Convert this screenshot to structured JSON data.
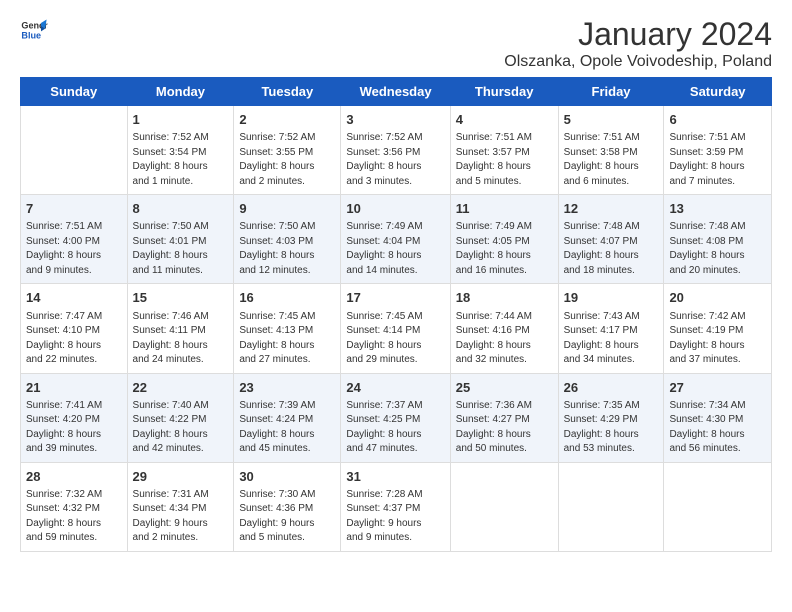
{
  "header": {
    "logo_line1": "General",
    "logo_line2": "Blue",
    "month_year": "January 2024",
    "location": "Olszanka, Opole Voivodeship, Poland"
  },
  "weekdays": [
    "Sunday",
    "Monday",
    "Tuesday",
    "Wednesday",
    "Thursday",
    "Friday",
    "Saturday"
  ],
  "weeks": [
    {
      "days": [
        {
          "num": "",
          "info": ""
        },
        {
          "num": "1",
          "info": "Sunrise: 7:52 AM\nSunset: 3:54 PM\nDaylight: 8 hours\nand 1 minute."
        },
        {
          "num": "2",
          "info": "Sunrise: 7:52 AM\nSunset: 3:55 PM\nDaylight: 8 hours\nand 2 minutes."
        },
        {
          "num": "3",
          "info": "Sunrise: 7:52 AM\nSunset: 3:56 PM\nDaylight: 8 hours\nand 3 minutes."
        },
        {
          "num": "4",
          "info": "Sunrise: 7:51 AM\nSunset: 3:57 PM\nDaylight: 8 hours\nand 5 minutes."
        },
        {
          "num": "5",
          "info": "Sunrise: 7:51 AM\nSunset: 3:58 PM\nDaylight: 8 hours\nand 6 minutes."
        },
        {
          "num": "6",
          "info": "Sunrise: 7:51 AM\nSunset: 3:59 PM\nDaylight: 8 hours\nand 7 minutes."
        }
      ]
    },
    {
      "days": [
        {
          "num": "7",
          "info": "Sunrise: 7:51 AM\nSunset: 4:00 PM\nDaylight: 8 hours\nand 9 minutes."
        },
        {
          "num": "8",
          "info": "Sunrise: 7:50 AM\nSunset: 4:01 PM\nDaylight: 8 hours\nand 11 minutes."
        },
        {
          "num": "9",
          "info": "Sunrise: 7:50 AM\nSunset: 4:03 PM\nDaylight: 8 hours\nand 12 minutes."
        },
        {
          "num": "10",
          "info": "Sunrise: 7:49 AM\nSunset: 4:04 PM\nDaylight: 8 hours\nand 14 minutes."
        },
        {
          "num": "11",
          "info": "Sunrise: 7:49 AM\nSunset: 4:05 PM\nDaylight: 8 hours\nand 16 minutes."
        },
        {
          "num": "12",
          "info": "Sunrise: 7:48 AM\nSunset: 4:07 PM\nDaylight: 8 hours\nand 18 minutes."
        },
        {
          "num": "13",
          "info": "Sunrise: 7:48 AM\nSunset: 4:08 PM\nDaylight: 8 hours\nand 20 minutes."
        }
      ]
    },
    {
      "days": [
        {
          "num": "14",
          "info": "Sunrise: 7:47 AM\nSunset: 4:10 PM\nDaylight: 8 hours\nand 22 minutes."
        },
        {
          "num": "15",
          "info": "Sunrise: 7:46 AM\nSunset: 4:11 PM\nDaylight: 8 hours\nand 24 minutes."
        },
        {
          "num": "16",
          "info": "Sunrise: 7:45 AM\nSunset: 4:13 PM\nDaylight: 8 hours\nand 27 minutes."
        },
        {
          "num": "17",
          "info": "Sunrise: 7:45 AM\nSunset: 4:14 PM\nDaylight: 8 hours\nand 29 minutes."
        },
        {
          "num": "18",
          "info": "Sunrise: 7:44 AM\nSunset: 4:16 PM\nDaylight: 8 hours\nand 32 minutes."
        },
        {
          "num": "19",
          "info": "Sunrise: 7:43 AM\nSunset: 4:17 PM\nDaylight: 8 hours\nand 34 minutes."
        },
        {
          "num": "20",
          "info": "Sunrise: 7:42 AM\nSunset: 4:19 PM\nDaylight: 8 hours\nand 37 minutes."
        }
      ]
    },
    {
      "days": [
        {
          "num": "21",
          "info": "Sunrise: 7:41 AM\nSunset: 4:20 PM\nDaylight: 8 hours\nand 39 minutes."
        },
        {
          "num": "22",
          "info": "Sunrise: 7:40 AM\nSunset: 4:22 PM\nDaylight: 8 hours\nand 42 minutes."
        },
        {
          "num": "23",
          "info": "Sunrise: 7:39 AM\nSunset: 4:24 PM\nDaylight: 8 hours\nand 45 minutes."
        },
        {
          "num": "24",
          "info": "Sunrise: 7:37 AM\nSunset: 4:25 PM\nDaylight: 8 hours\nand 47 minutes."
        },
        {
          "num": "25",
          "info": "Sunrise: 7:36 AM\nSunset: 4:27 PM\nDaylight: 8 hours\nand 50 minutes."
        },
        {
          "num": "26",
          "info": "Sunrise: 7:35 AM\nSunset: 4:29 PM\nDaylight: 8 hours\nand 53 minutes."
        },
        {
          "num": "27",
          "info": "Sunrise: 7:34 AM\nSunset: 4:30 PM\nDaylight: 8 hours\nand 56 minutes."
        }
      ]
    },
    {
      "days": [
        {
          "num": "28",
          "info": "Sunrise: 7:32 AM\nSunset: 4:32 PM\nDaylight: 8 hours\nand 59 minutes."
        },
        {
          "num": "29",
          "info": "Sunrise: 7:31 AM\nSunset: 4:34 PM\nDaylight: 9 hours\nand 2 minutes."
        },
        {
          "num": "30",
          "info": "Sunrise: 7:30 AM\nSunset: 4:36 PM\nDaylight: 9 hours\nand 5 minutes."
        },
        {
          "num": "31",
          "info": "Sunrise: 7:28 AM\nSunset: 4:37 PM\nDaylight: 9 hours\nand 9 minutes."
        },
        {
          "num": "",
          "info": ""
        },
        {
          "num": "",
          "info": ""
        },
        {
          "num": "",
          "info": ""
        }
      ]
    }
  ]
}
